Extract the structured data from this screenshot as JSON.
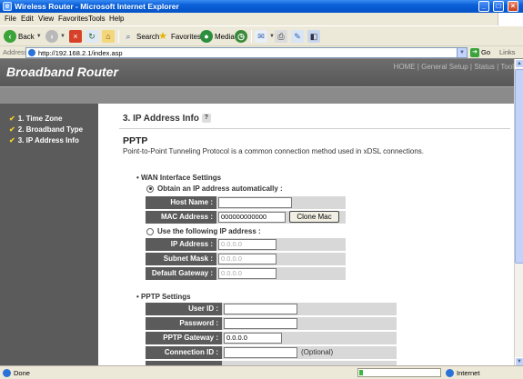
{
  "window": {
    "title": "Wireless Router - Microsoft Internet Explorer"
  },
  "menu": [
    "File",
    "Edit",
    "View",
    "Favorites",
    "Tools",
    "Help"
  ],
  "toolbar": {
    "back": "Back",
    "search": "Search",
    "favorites": "Favorites",
    "media": "Media"
  },
  "address": {
    "label": "Address",
    "url": "http://192.168.2.1/index.asp",
    "go": "Go",
    "links": "Links"
  },
  "banner": {
    "brand": "Broadband Router",
    "nav": [
      "HOME",
      "General Setup",
      "Status",
      "Tool"
    ]
  },
  "sidebar": {
    "items": [
      "1. Time Zone",
      "2. Broadband Type",
      "3. IP Address Info"
    ]
  },
  "page": {
    "title": "3. IP Address Info",
    "heading": "PPTP",
    "description": "Point-to-Point Tunneling Protocol is a common connection method used in xDSL connections.",
    "wan": {
      "heading": "WAN Interface Settings",
      "auto_label": "Obtain an IP address automatically :",
      "host_name_label": "Host Name :",
      "host_name_value": "",
      "mac_label": "MAC Address :",
      "mac_value": "000000000000",
      "clone_mac": "Clone Mac",
      "static_label": "Use the following IP address :",
      "ip_label": "IP Address :",
      "ip_value": "0.0.0.0",
      "subnet_label": "Subnet Mask :",
      "subnet_value": "0.0.0.0",
      "gateway_label": "Default Gateway :",
      "gateway_value": "0.0.0.0"
    },
    "pptp": {
      "heading": "PPTP Settings",
      "user_label": "User ID :",
      "user_value": "",
      "password_label": "Password :",
      "password_value": "",
      "gateway_label": "PPTP Gateway :",
      "gateway_value": "0.0.0.0",
      "connection_label": "Connection ID :",
      "connection_value": "",
      "optional": "(Optional)"
    }
  },
  "status": {
    "text": "Done",
    "zone": "Internet",
    "progress_fraction": 0.05
  }
}
